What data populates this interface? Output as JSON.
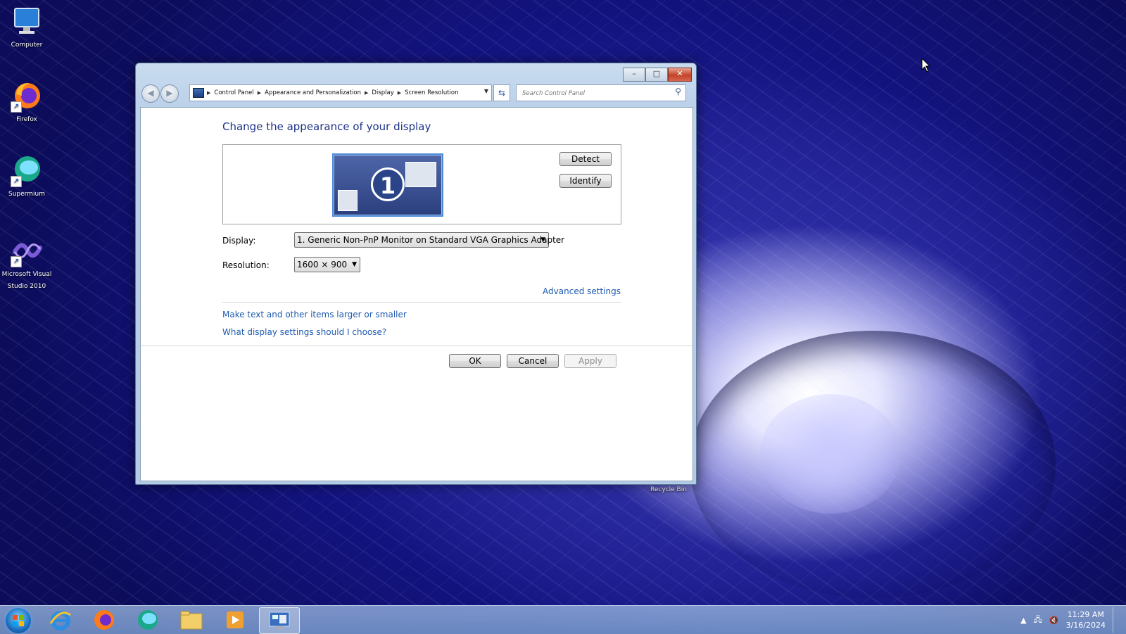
{
  "desktop": {
    "icons": [
      {
        "label": "Computer"
      },
      {
        "label": "Firefox"
      },
      {
        "label": "Supermium"
      },
      {
        "label": "Microsoft Visual Studio 2010"
      },
      {
        "label": "Recycle Bin"
      }
    ]
  },
  "window": {
    "caption_buttons": {
      "minimize": "–",
      "maximize": "□",
      "close": "✕"
    },
    "breadcrumb": [
      "Control Panel",
      "Appearance and Personalization",
      "Display",
      "Screen Resolution"
    ],
    "search_placeholder": "Search Control Panel",
    "heading": "Change the appearance of your display",
    "monitor_number": "1",
    "detect_label": "Detect",
    "identify_label": "Identify",
    "display_label": "Display:",
    "display_value": "1. Generic Non-PnP Monitor on Standard VGA Graphics Adapter",
    "resolution_label": "Resolution:",
    "resolution_value": "1600 × 900",
    "advanced_settings": "Advanced settings",
    "link_text_size": "Make text and other items larger or smaller",
    "link_help": "What display settings should I choose?",
    "ok_label": "OK",
    "cancel_label": "Cancel",
    "apply_label": "Apply"
  },
  "taskbar": {
    "items": [
      "start-button",
      "internet-explorer",
      "firefox",
      "supermium",
      "file-explorer",
      "media-player",
      "control-panel"
    ],
    "time": "11:29 AM",
    "date": "3/16/2024"
  }
}
